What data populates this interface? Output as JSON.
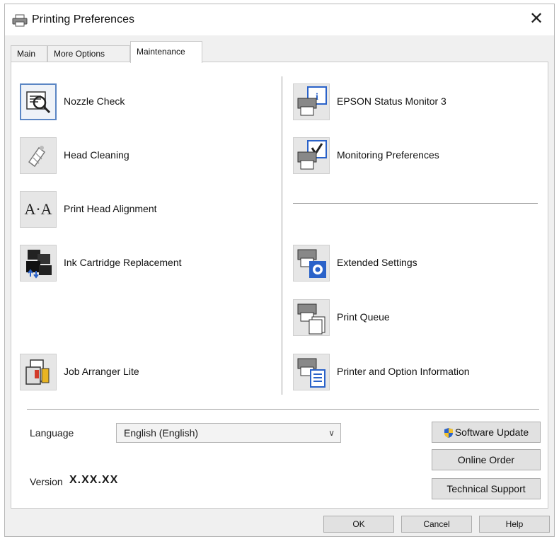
{
  "window": {
    "title": "Printing Preferences",
    "close_label": "✕"
  },
  "tabs": [
    {
      "label": "Main",
      "active": false
    },
    {
      "label": "More Options",
      "active": false
    },
    {
      "label": "Maintenance",
      "active": true
    }
  ],
  "left_tools": [
    {
      "label": "Nozzle Check",
      "icon": "nozzle-check-icon"
    },
    {
      "label": "Head Cleaning",
      "icon": "head-cleaning-icon"
    },
    {
      "label": "Print Head Alignment",
      "icon": "head-alignment-icon",
      "icon_text": "A·A"
    },
    {
      "label": "Ink Cartridge Replacement",
      "icon": "ink-cartridge-icon"
    },
    {
      "label": "Job Arranger Lite",
      "icon": "job-arranger-icon"
    }
  ],
  "right_tools": [
    {
      "label": "EPSON Status Monitor 3",
      "icon": "status-monitor-icon"
    },
    {
      "label": "Monitoring Preferences",
      "icon": "monitoring-preferences-icon"
    },
    {
      "label": "Extended Settings",
      "icon": "extended-settings-icon"
    },
    {
      "label": "Print Queue",
      "icon": "print-queue-icon"
    },
    {
      "label": "Printer and Option Information",
      "icon": "printer-info-icon"
    }
  ],
  "language": {
    "label": "Language",
    "value": "English (English)"
  },
  "version": {
    "label": "Version",
    "value": "X.XX.XX"
  },
  "side_buttons": {
    "software_update": "Software Update",
    "online_order": "Online Order",
    "technical_support": "Technical Support"
  },
  "footer": {
    "ok": "OK",
    "cancel": "Cancel",
    "help": "Help"
  },
  "colors": {
    "focus_border": "#5b86c4",
    "panel_bg": "#ffffff",
    "dialog_bg": "#f0f0f0"
  }
}
